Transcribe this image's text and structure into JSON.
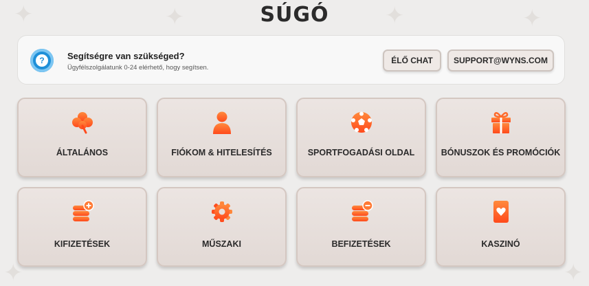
{
  "page": {
    "title": "SÚGÓ"
  },
  "help": {
    "icon": "question-icon",
    "heading": "Segítségre van szükséged?",
    "subtitle": "Ügyfélszolgálatunk 0-24 elérhető, hogy segítsen.",
    "chat_label": "ÉLŐ CHAT",
    "support_label": "SUPPORT@WYNS.COM"
  },
  "colors": {
    "accent": "#ff5a1f",
    "accent_light": "#ff8a3d",
    "info_blue": "#1e8fd8"
  },
  "categories": [
    {
      "label": "ÁLTALÁNOS",
      "icon": "clover-icon"
    },
    {
      "label": "FIÓKOM & HITELESÍTÉS",
      "icon": "user-icon"
    },
    {
      "label": "SPORTFOGADÁSI OLDAL",
      "icon": "soccer-ball-icon"
    },
    {
      "label": "BÓNUSZOK ÉS PROMÓCIÓK",
      "icon": "gift-icon"
    },
    {
      "label": "KIFIZETÉSEK",
      "icon": "coins-plus-icon"
    },
    {
      "label": "MŰSZAKI",
      "icon": "gear-icon"
    },
    {
      "label": "BEFIZETÉSEK",
      "icon": "coins-minus-icon"
    },
    {
      "label": "KASZINÓ",
      "icon": "playing-card-icon"
    }
  ]
}
